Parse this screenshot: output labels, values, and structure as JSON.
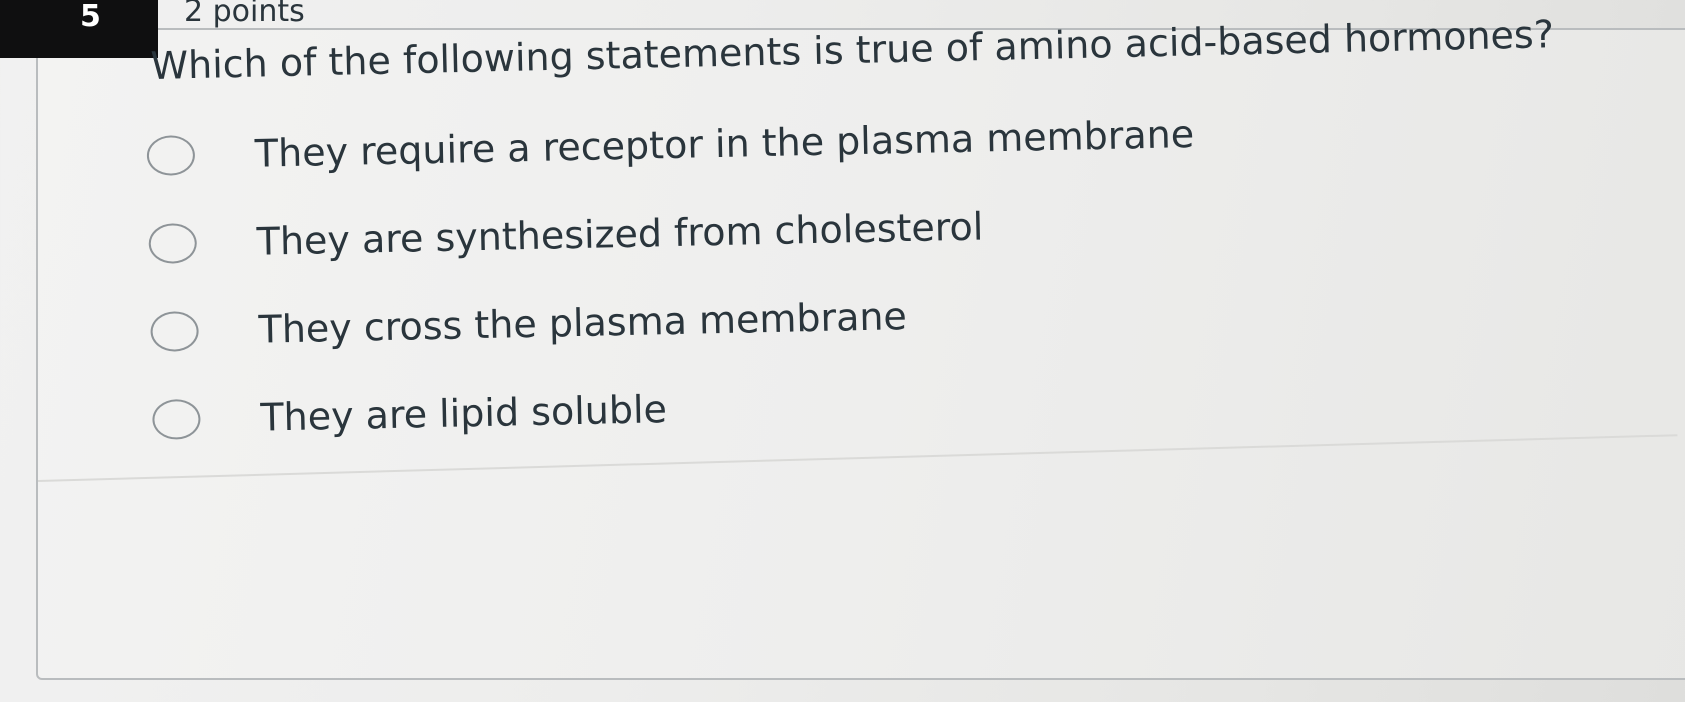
{
  "question": {
    "number": "5",
    "points": "2 points",
    "text": "Which of the following statements is true of amino acid-based hormones?",
    "options": [
      {
        "label": "They require a receptor in the plasma membrane"
      },
      {
        "label": "They are synthesized from cholesterol"
      },
      {
        "label": "They cross the plasma membrane"
      },
      {
        "label": "They are lipid soluble"
      }
    ]
  }
}
